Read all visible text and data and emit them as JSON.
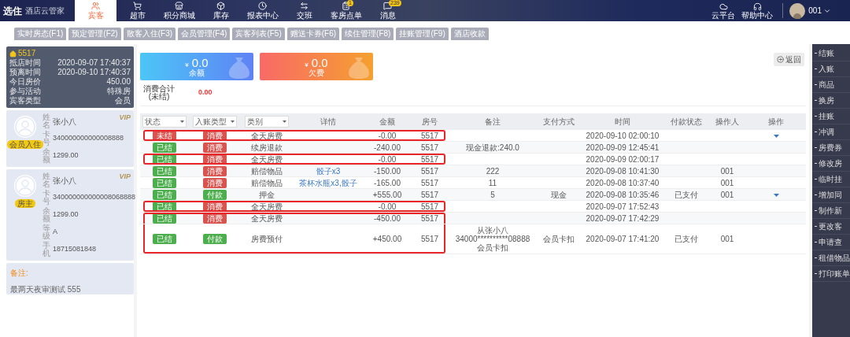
{
  "header": {
    "logo_main": "选住",
    "logo_sub": "酒店云管家",
    "nav": [
      {
        "label": "宾客",
        "selected": true
      },
      {
        "label": "超市",
        "selected": false
      },
      {
        "label": "积分商城",
        "selected": false
      },
      {
        "label": "库存",
        "selected": false
      },
      {
        "label": "报表中心",
        "selected": false
      },
      {
        "label": "交班",
        "selected": false
      },
      {
        "label": "客房点单",
        "selected": false,
        "badge": "1"
      },
      {
        "label": "消息",
        "selected": false,
        "badge": "239"
      }
    ],
    "tools": [
      {
        "label": "云平台"
      },
      {
        "label": "帮助中心"
      }
    ],
    "user": "001"
  },
  "tabs": [
    "实时房态(F1)",
    "预定管理(F2)",
    "散客入住(F3)",
    "会员管理(F4)",
    "宾客列表(F5)",
    "赠送卡券(F6)",
    "续住管理(F8)",
    "挂账管理(F9)",
    "酒店收款"
  ],
  "room": {
    "number": "5517",
    "rows": [
      {
        "label": "抵店时间",
        "value": "2020-09-07 17:40:37"
      },
      {
        "label": "预离时间",
        "value": "2020-09-10 17:40:37"
      },
      {
        "label": "今日房价",
        "value": "450.00"
      },
      {
        "label": "参与活动",
        "value": "特殊房"
      },
      {
        "label": "宾客类型",
        "value": "会员"
      }
    ]
  },
  "guests": [
    {
      "badge": "会员入住",
      "vip": "VIP",
      "fields": [
        {
          "label": "姓名",
          "value": "张小八"
        },
        {
          "label": "卡号",
          "value": "340000000000008888"
        },
        {
          "label": "余额",
          "value": "1299.00"
        }
      ]
    },
    {
      "badge": "房主",
      "vip": "VIP",
      "fields": [
        {
          "label": "姓名",
          "value": "张小八"
        },
        {
          "label": "卡号",
          "value": "340000000000008068888"
        },
        {
          "label": "余额",
          "value": "1299.00"
        },
        {
          "label": "等级",
          "value": "A"
        },
        {
          "label": "手机",
          "value": "18715081848"
        }
      ]
    }
  ],
  "note": {
    "label": "备注:",
    "text": "最两天夜审测试 555"
  },
  "summary_cards": [
    {
      "kind": "balance",
      "amount": "0.0",
      "currency": "¥",
      "label": "余额"
    },
    {
      "kind": "debt",
      "amount": "0.0",
      "currency": "¥",
      "label": "欠费"
    }
  ],
  "total": {
    "label": "消费合计\n(未结)",
    "value": "0.00"
  },
  "back_button": "返回",
  "filters": [
    {
      "label": "状态"
    },
    {
      "label": "入账类型"
    },
    {
      "label": "类别"
    }
  ],
  "columns": [
    "详情",
    "金额",
    "房号",
    "备注",
    "支付方式",
    "时间",
    "付款状态",
    "操作人",
    "操作"
  ],
  "rows": [
    {
      "status": {
        "text": "未结",
        "color": "#d9534f"
      },
      "type": {
        "text": "消费",
        "color": "#d9534f"
      },
      "category": "全天房费",
      "detail": "",
      "amount": "-0.00",
      "room": "5517",
      "remark": "",
      "payment": "",
      "time": "2020-09-10 02:00:10",
      "pay_state": "",
      "operator": "",
      "has_action": true,
      "framed": true,
      "frame_joins_next": false
    },
    {
      "status": {
        "text": "已结",
        "color": "#4cae4c"
      },
      "type": {
        "text": "消费",
        "color": "#d9534f"
      },
      "category": "续房退款",
      "detail": "",
      "amount": "-240.00",
      "room": "5517",
      "remark": "现金退款:240.0",
      "payment": "",
      "time": "2020-09-09 12:45:41",
      "pay_state": "",
      "operator": "",
      "has_action": false,
      "framed": false
    },
    {
      "status": {
        "text": "已结",
        "color": "#4cae4c"
      },
      "type": {
        "text": "消费",
        "color": "#d9534f"
      },
      "category": "全天房费",
      "detail": "",
      "amount": "-0.00",
      "room": "5517",
      "remark": "",
      "payment": "",
      "time": "2020-09-09 02:00:17",
      "pay_state": "",
      "operator": "",
      "has_action": false,
      "framed": true,
      "frame_joins_next": false
    },
    {
      "status": {
        "text": "已结",
        "color": "#4cae4c"
      },
      "type": {
        "text": "消费",
        "color": "#d9534f"
      },
      "category": "赔偿物品",
      "detail": "骰子x3",
      "amount": "-150.00",
      "room": "5517",
      "remark": "222",
      "payment": "",
      "time": "2020-09-08 10:41:30",
      "pay_state": "",
      "operator": "001",
      "has_action": false,
      "framed": false
    },
    {
      "status": {
        "text": "已结",
        "color": "#4cae4c"
      },
      "type": {
        "text": "消费",
        "color": "#d9534f"
      },
      "category": "赔偿物品",
      "detail": "茶杯水瓶x3,骰子",
      "amount": "-165.00",
      "room": "5517",
      "remark": "11",
      "payment": "",
      "time": "2020-09-08 10:37:40",
      "pay_state": "",
      "operator": "001",
      "has_action": false,
      "framed": false
    },
    {
      "status": {
        "text": "已结",
        "color": "#4cae4c"
      },
      "type": {
        "text": "付款",
        "color": "#4cae4c"
      },
      "category": "押金",
      "detail": "",
      "amount": "+555.00",
      "room": "5517",
      "remark": "5",
      "payment": "现金",
      "time": "2020-09-08 10:35:46",
      "pay_state": "已支付",
      "operator": "001",
      "has_action": true,
      "framed": false
    },
    {
      "status": {
        "text": "已结",
        "color": "#4cae4c"
      },
      "type": {
        "text": "消费",
        "color": "#d9534f"
      },
      "category": "全天房费",
      "detail": "",
      "amount": "-0.00",
      "room": "5517",
      "remark": "",
      "payment": "",
      "time": "2020-09-07 17:52:43",
      "pay_state": "",
      "operator": "",
      "has_action": false,
      "framed": true,
      "frame_joins_next": false
    },
    {
      "status": {
        "text": "已结",
        "color": "#4cae4c"
      },
      "type": {
        "text": "消费",
        "color": "#d9534f"
      },
      "category": "全天房费",
      "detail": "",
      "amount": "-450.00",
      "room": "5517",
      "remark": "",
      "payment": "",
      "time": "2020-09-07 17:42:29",
      "pay_state": "",
      "operator": "",
      "has_action": false,
      "framed": true,
      "frame_joins_next": true
    },
    {
      "status": {
        "text": "已结",
        "color": "#4cae4c"
      },
      "type": {
        "text": "付款",
        "color": "#4cae4c"
      },
      "category": "房费预付",
      "detail": "",
      "amount": "+450.00",
      "room": "5517",
      "remark": "从张小八\n34000**********08888\n会员卡扣",
      "payment": "会员卡扣",
      "time": "2020-09-07 17:41:20",
      "pay_state": "已支付",
      "operator": "001",
      "has_action": false,
      "framed": true,
      "frame_joins_next": false
    }
  ],
  "side_actions": [
    "结账",
    "入账",
    "商品",
    "换房",
    "挂账",
    "冲调",
    "房费券",
    "修改房",
    "临时挂",
    "增加同",
    "制作新",
    "更改客",
    "申请查",
    "租借物品",
    "打印账单"
  ]
}
